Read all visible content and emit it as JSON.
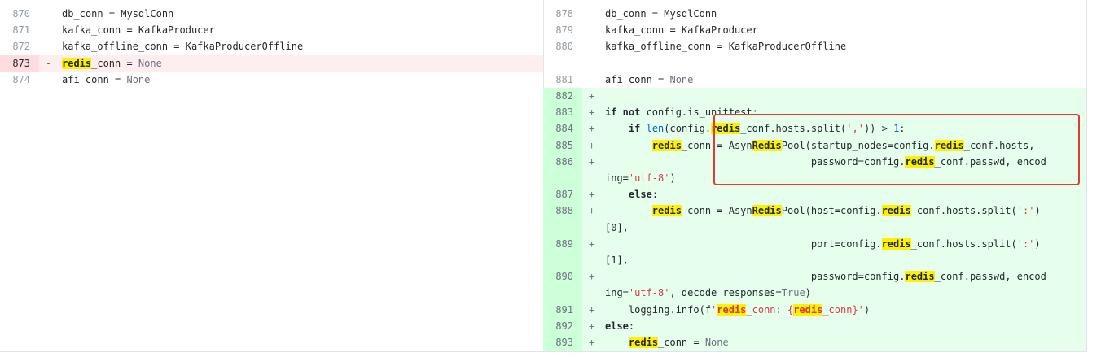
{
  "left": {
    "rows": [
      {
        "num": "870",
        "sign": "",
        "code": "db_conn = MysqlConn",
        "type": "ctx"
      },
      {
        "num": "871",
        "sign": "",
        "code": "kafka_conn = KafkaProducer",
        "type": "ctx"
      },
      {
        "num": "872",
        "sign": "",
        "code": "kafka_offline_conn = KafkaProducerOffline",
        "type": "ctx"
      },
      {
        "num": "873",
        "sign": "-",
        "code": "redis_conn = None",
        "type": "del"
      },
      {
        "num": "874",
        "sign": "",
        "code": "afi_conn = None",
        "type": "ctx"
      }
    ]
  },
  "right": {
    "rows": [
      {
        "num": "878",
        "sign": "",
        "code": "db_conn = MysqlConn",
        "type": "ctx"
      },
      {
        "num": "879",
        "sign": "",
        "code": "kafka_conn = KafkaProducer",
        "type": "ctx"
      },
      {
        "num": "880",
        "sign": "",
        "code": "kafka_offline_conn = KafkaProducerOffline",
        "type": "ctx"
      },
      {
        "num": "",
        "sign": "",
        "code": "",
        "type": "empty"
      },
      {
        "num": "881",
        "sign": "",
        "code": "afi_conn = None",
        "type": "ctx"
      },
      {
        "num": "882",
        "sign": "+",
        "code": "",
        "type": "add"
      },
      {
        "num": "883",
        "sign": "+",
        "code": "if not config.is_unittest:",
        "type": "add"
      },
      {
        "num": "884",
        "sign": "+",
        "code": "    if len(config.redis_conf.hosts.split(',')) > 1:",
        "type": "add"
      },
      {
        "num": "885",
        "sign": "+",
        "code": "        redis_conn = AsynRedisPool(startup_nodes=config.redis_conf.hosts,",
        "type": "add"
      },
      {
        "num": "886",
        "sign": "+",
        "code": "                                   password=config.redis_conf.passwd, encod",
        "type": "add"
      },
      {
        "num": "",
        "sign": "",
        "code": "ing='utf-8')",
        "type": "add-cont"
      },
      {
        "num": "887",
        "sign": "+",
        "code": "    else:",
        "type": "add"
      },
      {
        "num": "888",
        "sign": "+",
        "code": "        redis_conn = AsynRedisPool(host=config.redis_conf.hosts.split(':')",
        "type": "add"
      },
      {
        "num": "",
        "sign": "",
        "code": "[0],",
        "type": "add-cont"
      },
      {
        "num": "889",
        "sign": "+",
        "code": "                                   port=config.redis_conf.hosts.split(':')",
        "type": "add"
      },
      {
        "num": "",
        "sign": "",
        "code": "[1],",
        "type": "add-cont"
      },
      {
        "num": "890",
        "sign": "+",
        "code": "                                   password=config.redis_conf.passwd, encod",
        "type": "add"
      },
      {
        "num": "",
        "sign": "",
        "code": "ing='utf-8', decode_responses=True)",
        "type": "add-cont"
      },
      {
        "num": "891",
        "sign": "+",
        "code": "    logging.info(f'redis_conn: {redis_conn}')",
        "type": "add"
      },
      {
        "num": "892",
        "sign": "+",
        "code": "else:",
        "type": "add"
      },
      {
        "num": "893",
        "sign": "+",
        "code": "    redis_conn = None",
        "type": "add"
      }
    ]
  },
  "highlight_term": "redis",
  "colors": {
    "highlight": "#fff200",
    "annotation_box": "#e53935",
    "added_bg": "#e6ffed",
    "deleted_bg": "#ffeef0"
  }
}
